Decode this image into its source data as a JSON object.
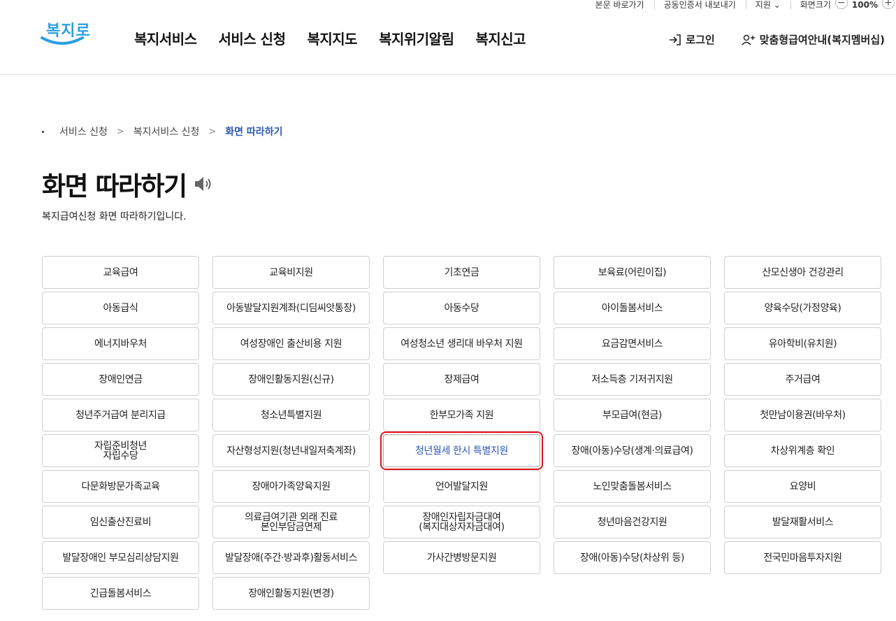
{
  "utility": {
    "items": [
      "본문 바로가기",
      "공동인증서 내보내기",
      "지원 ⌄",
      "화면크기"
    ],
    "zoom_minus": "−",
    "zoom_value": "100%",
    "zoom_plus": "+"
  },
  "header": {
    "logo_text": "복지로",
    "nav": [
      "복지서비스",
      "서비스 신청",
      "복지지도",
      "복지위기알림",
      "복지신고"
    ],
    "login": "로그인",
    "custom_guide": "맞춤형급여안내(복지멤버십)"
  },
  "breadcrumb": {
    "items": [
      "서비스 신청",
      "복지서비스 신청",
      "화면 따라하기"
    ],
    "separator": ">"
  },
  "page": {
    "title": "화면 따라하기",
    "description": "복지급여신청 화면 따라하기입니다."
  },
  "services": [
    "교육급여",
    "교육비지원",
    "기초연금",
    "보육료(어린이집)",
    "산모신생아 건강관리",
    "아동급식",
    "아동발달지원계좌(디딤씨앗통장)",
    "아동수당",
    "아이돌봄서비스",
    "양육수당(가정양육)",
    "에너지바우처",
    "여성장애인 출산비용 지원",
    "여성청소년 생리대 바우처 지원",
    "요금감면서비스",
    "유아학비(유치원)",
    "장애인연금",
    "장애인활동지원(신규)",
    "장제급여",
    "저소득층 기저귀지원",
    "주거급여",
    "청년주거급여 분리지급",
    "청소년특별지원",
    "한부모가족 지원",
    "부모급여(현금)",
    "첫만남이용권(바우처)",
    "자립준비청년\n자립수당",
    "자산형성지원(청년내일저축계좌)",
    "청년월세 한시 특별지원",
    "장애(아동)수당(생계·의료급여)",
    "차상위계층 확인",
    "다문화방문가족교육",
    "장애아가족양육지원",
    "언어발달지원",
    "노인맞춤돌봄서비스",
    "요양비",
    "임신출산진료비",
    "의료급여기관 외래 진료\n본인부담금면제",
    "장애인자립자금대여\n(복지대상자자금대여)",
    "청년마음건강지원",
    "발달재활서비스",
    "발달장애인 부모심리상담지원",
    "발달장애(주간·방과후)활동서비스",
    "가사간병방문지원",
    "장애(아동)수당(차상위 등)",
    "전국민마음투자지원",
    "긴급돌봄서비스",
    "장애인활동지원(변경)"
  ],
  "active_service": "청년월세 한시 특별지원",
  "colors": {
    "logo": "#2a9fe0",
    "accent": "#2d57b6",
    "highlight": "#e3141b"
  }
}
